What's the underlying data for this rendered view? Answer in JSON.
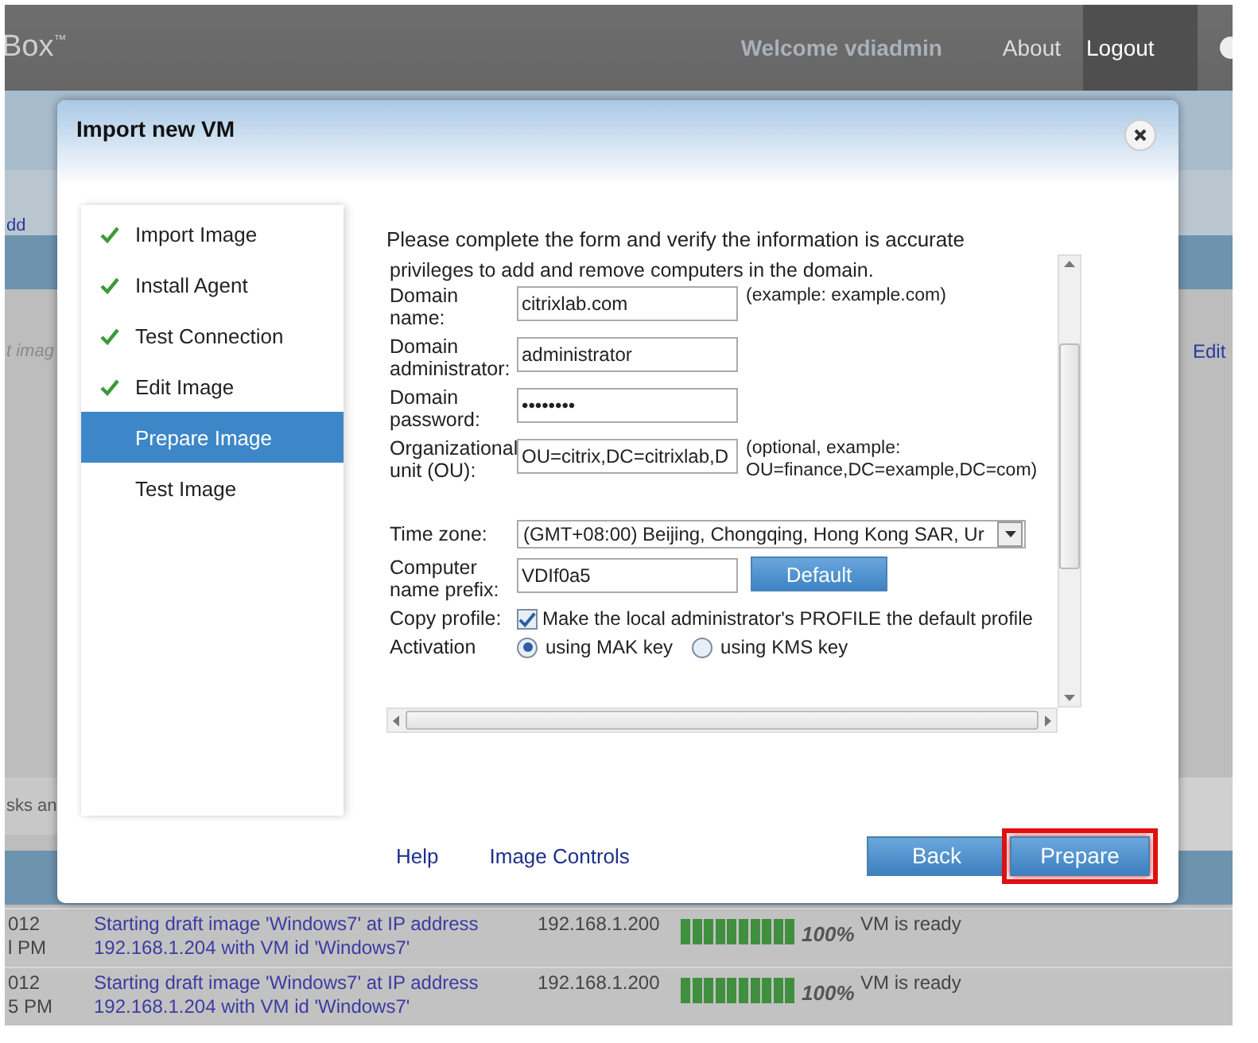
{
  "header": {
    "logo": "Box$^{™}$",
    "welcome": "Welcome vdiadmin",
    "links": [
      "About",
      "Logout"
    ]
  },
  "background": {
    "left_link": "dd",
    "left_note": "t imag",
    "left_footer": "sks an",
    "right_link": "Edit"
  },
  "dialog": {
    "title": "Import new VM",
    "steps": [
      {
        "label": "Import Image",
        "done": true,
        "selected": false
      },
      {
        "label": "Install Agent",
        "done": true,
        "selected": false
      },
      {
        "label": "Test Connection",
        "done": true,
        "selected": false
      },
      {
        "label": "Edit Image",
        "done": true,
        "selected": false
      },
      {
        "label": "Prepare Image",
        "done": false,
        "selected": true
      },
      {
        "label": "Test Image",
        "done": false,
        "selected": false
      }
    ],
    "intro": "Please complete the form and verify the information is accurate",
    "form_note": "privileges to add and remove computers in the domain.",
    "fields": [
      {
        "kind": "text",
        "label": "Domain name:",
        "value": "citrixlab.com",
        "hint": "(example: example.com)"
      },
      {
        "kind": "text",
        "label": "Domain administrator:",
        "value": "administrator"
      },
      {
        "kind": "password",
        "label": "Domain password:",
        "value": "••••••••"
      },
      {
        "kind": "text",
        "label": "Organizational unit (OU):",
        "value": "OU=citrix,DC=citrixlab,D",
        "hint": "(optional, example: OU=finance,DC=example,DC=com)"
      },
      {
        "kind": "select",
        "label": "Time zone:",
        "value": "(GMT+08:00) Beijing, Chongqing, Hong Kong SAR, Ur"
      },
      {
        "kind": "button",
        "label": "Computer name prefix:",
        "value": "VDIf0a5",
        "button": "Default"
      },
      {
        "kind": "checkbox",
        "label": "Copy profile:",
        "checked": true,
        "text": "Make the local administrator's PROFILE the default profile"
      },
      {
        "kind": "radio",
        "label": "Activation",
        "options": [
          {
            "label": "using MAK key",
            "selected": true
          },
          {
            "label": "using KMS key",
            "selected": false
          }
        ]
      }
    ],
    "footer_links": [
      "Help",
      "Image Controls"
    ],
    "buttons": [
      {
        "label": "Back",
        "highlighted": false
      },
      {
        "label": "Prepare",
        "highlighted": true
      }
    ]
  },
  "table_rows": [
    {
      "date": [
        "012",
        "l PM"
      ],
      "description": "Starting draft image 'Windows7' at IP address 192.168.1.204 with VM id 'Windows7'",
      "ip": "192.168.1.200",
      "level": 1,
      "percent": "100%",
      "status": "VM is ready"
    },
    {
      "date": [
        "012",
        "5 PM"
      ],
      "description": "Starting draft image 'Windows7' at IP address 192.168.1.204 with VM id 'Windows7'",
      "ip": "192.168.1.200",
      "level": 1,
      "percent": "100%",
      "status": "VM is ready"
    }
  ]
}
